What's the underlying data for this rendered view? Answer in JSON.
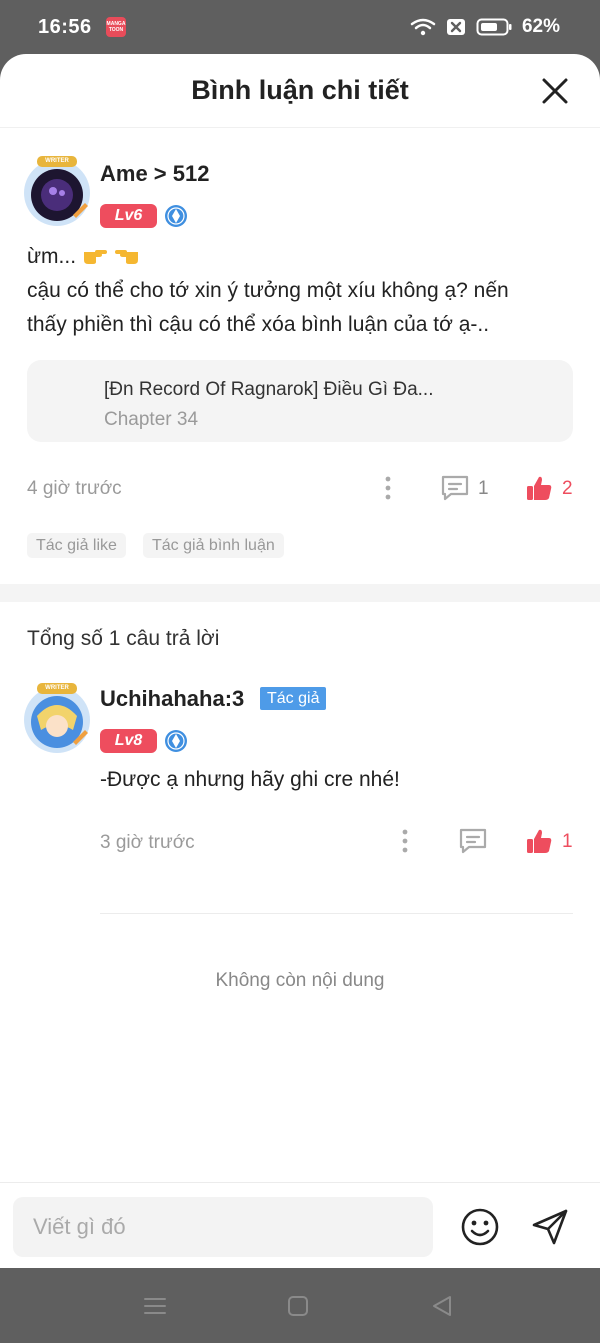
{
  "status_bar": {
    "time": "16:56",
    "app_badge": "MANGA TOON",
    "battery": "62%"
  },
  "header": {
    "title": "Bình luận chi tiết"
  },
  "comment": {
    "username": "Ame > 512",
    "level": "Lv6",
    "text_line1": "ừm...",
    "text_line2": "cậu có thể cho tớ xin ý tưởng một xíu không ạ? nến",
    "text_line3": "thấy phiền thì cậu có thể xóa bình luận của tớ ạ-..",
    "story_title": "[Đn Record Of Ragnarok] Điều Gì Đa...",
    "story_chapter": "Chapter 34",
    "time": "4 giờ trước",
    "reply_count": "1",
    "like_count": "2",
    "tags": [
      "Tác giả like",
      "Tác giả bình luận"
    ]
  },
  "replies_section": {
    "total_label": "Tổng số 1 câu trả lời"
  },
  "reply": {
    "username": "Uchihahaha:3",
    "author_badge": "Tác giả",
    "level": "Lv8",
    "text": "-Được ạ nhưng hãy ghi cre nhé!",
    "time": "3 giờ trước",
    "like_count": "1"
  },
  "end_of_list": "Không còn nội dung",
  "composer": {
    "placeholder": "Viết gì đó"
  },
  "avatar_label": "WRITER",
  "colors": {
    "accent": "#ee4d5e",
    "author_badge": "#4e9be8",
    "muted_text": "#9a9a9a"
  },
  "icons": [
    "close-icon",
    "more-icon",
    "reply-icon",
    "like-icon",
    "emoji-icon",
    "send-icon",
    "menu-icon",
    "home-icon",
    "back-icon"
  ]
}
